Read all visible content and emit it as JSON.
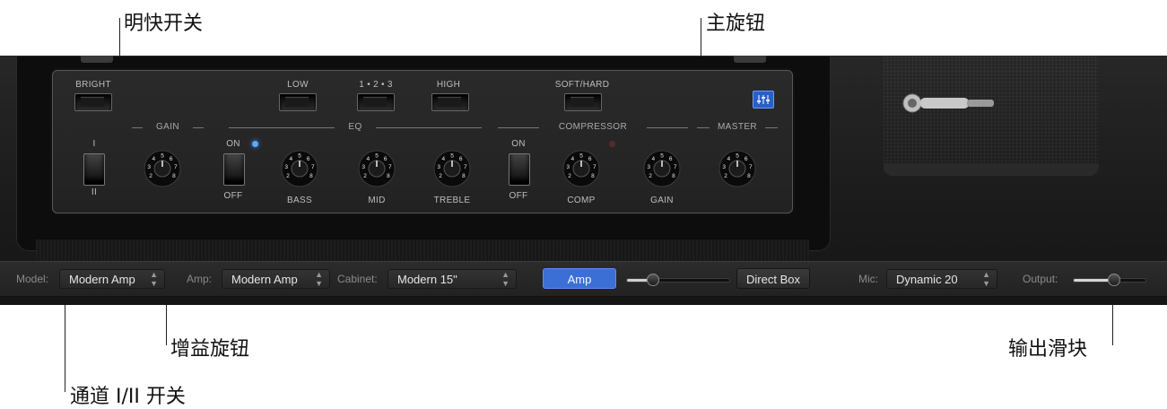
{
  "callouts": {
    "bright_switch": "明快开关",
    "master_knob": "主旋钮",
    "gain_knob": "增益旋钮",
    "output_slider": "输出滑块",
    "channel_switch": "通道 I/II 开关"
  },
  "amp_panel": {
    "switch_labels": {
      "bright": "BRIGHT",
      "low": "LOW",
      "mid_position": "1 • 2 • 3",
      "high": "HIGH",
      "soft_hard": "SOFT/HARD"
    },
    "sections": {
      "gain": "GAIN",
      "eq": "EQ",
      "compressor": "COMPRESSOR",
      "master": "MASTER"
    },
    "channel": {
      "one": "I",
      "two": "II"
    },
    "eq_toggle": {
      "on": "ON",
      "off": "OFF"
    },
    "comp_toggle": {
      "on": "ON",
      "off": "OFF"
    },
    "knob_labels": {
      "bass": "BASS",
      "mid": "MID",
      "treble": "TREBLE",
      "comp": "COMP",
      "comp_gain": "GAIN"
    },
    "knob_scale": [
      "2",
      "3",
      "4",
      "5",
      "6",
      "7",
      "8"
    ],
    "accent_led": "#4a9bff",
    "settings_icon": "eq-settings-icon"
  },
  "toolbar": {
    "model_label": "Model:",
    "model_value": "Modern Amp",
    "amp_label": "Amp:",
    "amp_value": "Modern Amp",
    "cabinet_label": "Cabinet:",
    "cabinet_value": "Modern 15\"",
    "amp_button": "Amp",
    "direct_box_button": "Direct Box",
    "mic_label": "Mic:",
    "mic_value": "Dynamic 20",
    "output_label": "Output:",
    "blend_slider_value": 0.25,
    "output_slider_value": 0.55,
    "accent_color": "#3b6fd6"
  }
}
